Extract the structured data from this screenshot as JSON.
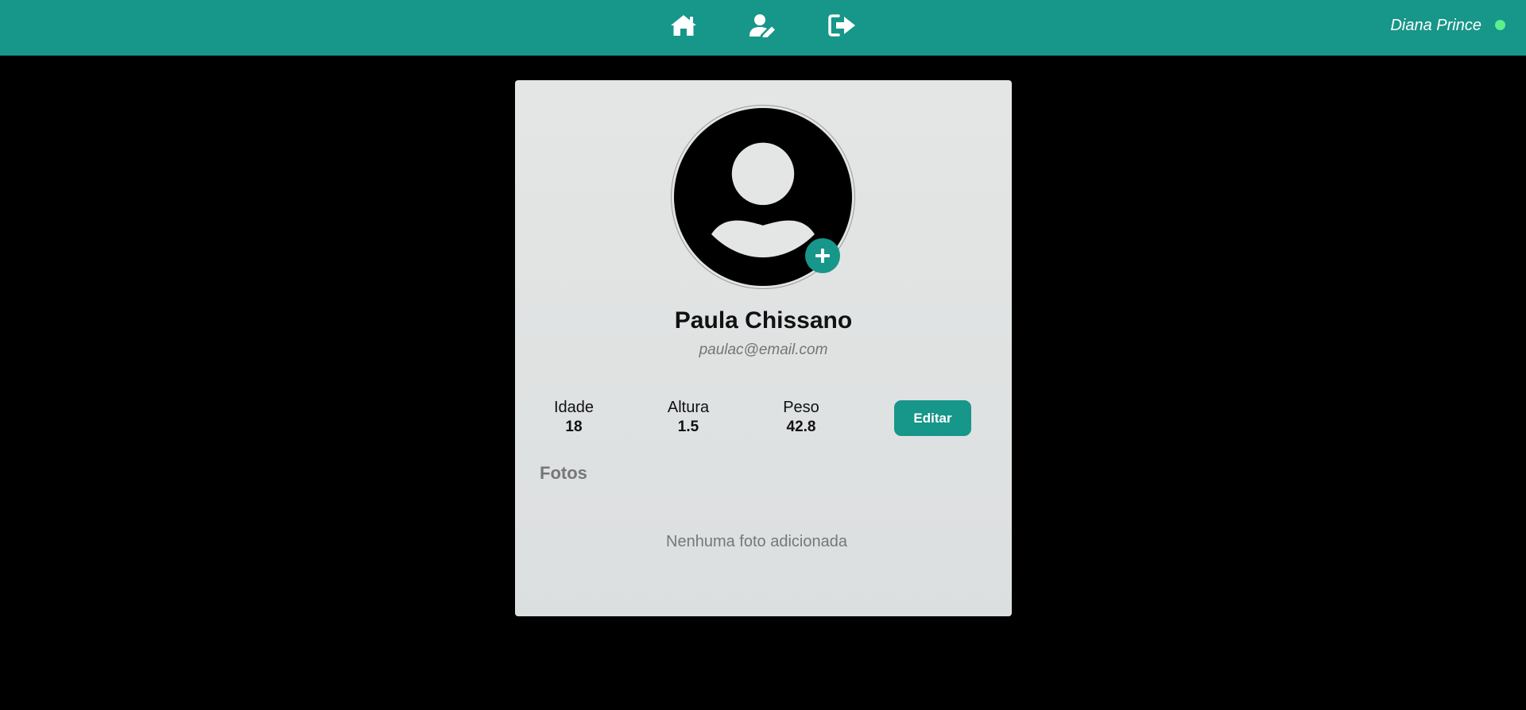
{
  "header": {
    "nav": [
      {
        "icon": "home-icon"
      },
      {
        "icon": "user-edit-icon"
      },
      {
        "icon": "logout-icon"
      }
    ],
    "user_name": "Diana Prince",
    "status": "online",
    "status_color": "#5cf08c",
    "background_color": "#17968a"
  },
  "profile": {
    "avatar_icon": "user-avatar-icon",
    "add_photo_icon": "plus-icon",
    "name": "Paula Chissano",
    "email": "paulac@email.com",
    "stats": [
      {
        "label": "Idade",
        "value": "18"
      },
      {
        "label": "Altura",
        "value": "1.5"
      },
      {
        "label": "Peso",
        "value": "42.8"
      }
    ],
    "edit_label": "Editar",
    "photos_title": "Fotos",
    "photos_empty_text": "Nenhuma foto adicionada"
  },
  "colors": {
    "accent": "#17968a",
    "page_background": "#000000",
    "card_background": "#e1e3e3"
  }
}
